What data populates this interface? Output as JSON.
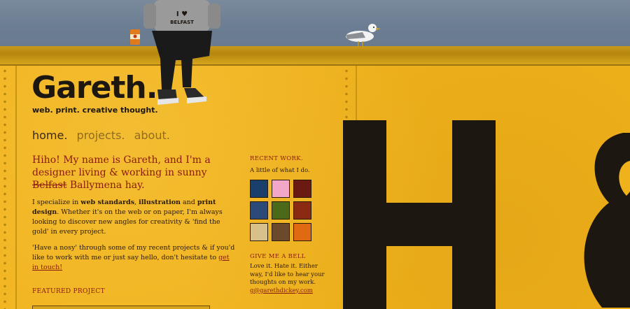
{
  "logo": {
    "name": "Gareth.",
    "tagline": "web. print. creative thought."
  },
  "tshirt_text": "BELFAST",
  "nav": [
    {
      "label": "home.",
      "active": true
    },
    {
      "label": "projects.",
      "active": false
    },
    {
      "label": "about.",
      "active": false
    }
  ],
  "intro": {
    "part1": "Hiho! My name is Gareth, and I'm a designer living & working in sunny ",
    "struck": "Belfast",
    "part2": " Ballymena hay."
  },
  "paragraph1": {
    "t1": "I specialize in ",
    "b1": "web standards",
    "t2": ", ",
    "b2": "illustration",
    "t3": " and ",
    "b3": "print design",
    "t4": ". Whether it's on the web or on paper, I'm always looking to discover new angles for creativity & 'find the gold' in every project."
  },
  "paragraph2": {
    "text": "'Have a nosy' through some of my recent projects & if you'd like to work with me or just say hello, don't hesitate to ",
    "link": "get in touch!"
  },
  "featured_label": "FEATURED PROJECT",
  "recent_work": {
    "heading": "RECENT WORK.",
    "sub": "A little of what I do.",
    "thumbs": [
      {
        "name": "thumb-1",
        "color": "#1b3f6b"
      },
      {
        "name": "thumb-2",
        "color": "#f2a7c8"
      },
      {
        "name": "thumb-3",
        "color": "#6a1a12"
      },
      {
        "name": "thumb-4",
        "color": "#2b4a7a"
      },
      {
        "name": "thumb-5",
        "color": "#4a6a1a"
      },
      {
        "name": "thumb-6",
        "color": "#8a2a12"
      },
      {
        "name": "thumb-7",
        "color": "#d8c08a"
      },
      {
        "name": "thumb-8",
        "color": "#6a4a2a"
      },
      {
        "name": "thumb-9",
        "color": "#e06a12"
      }
    ]
  },
  "contact": {
    "heading": "GIVE ME A BELL",
    "text": "Love it. Hate it. Either way, I'd like to hear your thoughts on my work.",
    "email": "g@garethdickey.com"
  },
  "colors": {
    "wall": "#f0b21a",
    "sky": "#6b7d92",
    "accent": "#8a1a10",
    "dark": "#1d1712"
  }
}
